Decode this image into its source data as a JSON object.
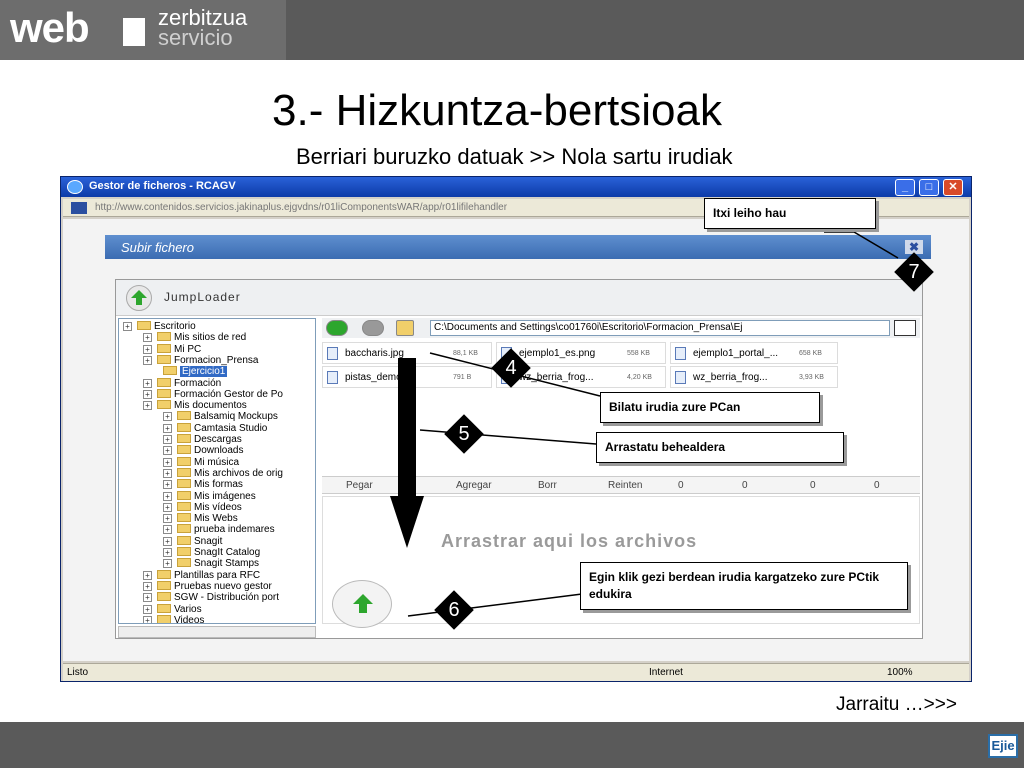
{
  "header": {
    "logo_web": "web",
    "logo_zerbitzua": "zerbitzua",
    "logo_servicio": "servicio"
  },
  "slide": {
    "title": "3.- Hizkuntza-bertsioak",
    "subtitle": "Berriari buruzko datuak >> Nola sartu irudiak",
    "next_link": "Jarraitu …>>>",
    "footer_logo": "Ejie"
  },
  "browser": {
    "title": "Gestor de ficheros - RCAGV",
    "url": "http://www.contenidos.servicios.jakinaplus.ejgvdns/r01liComponentsWAR/app/r01lifilehandler",
    "status_left": "Listo",
    "status_zone": "Internet",
    "status_zoom": "100%"
  },
  "dialog": {
    "title": "Subir fichero",
    "close": "✖"
  },
  "jumploader": {
    "title": "JumpLoader",
    "path": "C:\\Documents and Settings\\co01760i\\Escritorio\\Formacion_Prensa\\Ej",
    "tree": [
      {
        "label": "Escritorio",
        "indent": 0,
        "sel": false
      },
      {
        "label": "Mis sitios de red",
        "indent": 1,
        "sel": false
      },
      {
        "label": "Mi PC",
        "indent": 1,
        "sel": false
      },
      {
        "label": "Formacion_Prensa",
        "indent": 1,
        "sel": false
      },
      {
        "label": "Ejercicio1",
        "indent": 2,
        "sel": true
      },
      {
        "label": "Formación",
        "indent": 1,
        "sel": false
      },
      {
        "label": "Formación Gestor de Po",
        "indent": 1,
        "sel": false
      },
      {
        "label": "Mis documentos",
        "indent": 1,
        "sel": false
      },
      {
        "label": "Balsamiq Mockups",
        "indent": 2,
        "sel": false
      },
      {
        "label": "Camtasia Studio",
        "indent": 2,
        "sel": false
      },
      {
        "label": "Descargas",
        "indent": 2,
        "sel": false
      },
      {
        "label": "Downloads",
        "indent": 2,
        "sel": false
      },
      {
        "label": "Mi música",
        "indent": 2,
        "sel": false
      },
      {
        "label": "Mis archivos de orig",
        "indent": 2,
        "sel": false
      },
      {
        "label": "Mis formas",
        "indent": 2,
        "sel": false
      },
      {
        "label": "Mis imágenes",
        "indent": 2,
        "sel": false
      },
      {
        "label": "Mis vídeos",
        "indent": 2,
        "sel": false
      },
      {
        "label": "Mis Webs",
        "indent": 2,
        "sel": false
      },
      {
        "label": "prueba indemares",
        "indent": 2,
        "sel": false
      },
      {
        "label": "Snagit",
        "indent": 2,
        "sel": false
      },
      {
        "label": "SnagIt Catalog",
        "indent": 2,
        "sel": false
      },
      {
        "label": "Snagit Stamps",
        "indent": 2,
        "sel": false
      },
      {
        "label": "Plantillas para RFC",
        "indent": 1,
        "sel": false
      },
      {
        "label": "Pruebas nuevo gestor",
        "indent": 1,
        "sel": false
      },
      {
        "label": "SGW - Distribución port",
        "indent": 1,
        "sel": false
      },
      {
        "label": "Varios",
        "indent": 1,
        "sel": false
      },
      {
        "label": "Videos",
        "indent": 1,
        "sel": false
      }
    ],
    "files": [
      {
        "name": "baccharis.jpg",
        "size": "88,1 KB"
      },
      {
        "name": "ejemplo1_es.png",
        "size": "558 KB"
      },
      {
        "name": "ejemplo1_portal_...",
        "size": "658 KB"
      },
      {
        "name": "pistas_demo.txt",
        "size": "791 B"
      },
      {
        "name": "wz_berria_frog...",
        "size": "4,20 KB"
      },
      {
        "name": "wz_berria_frog...",
        "size": "3,93 KB"
      }
    ],
    "toolbar": {
      "paste": "Pegar",
      "add": "Agregar",
      "delete": "Borr",
      "retry": "Reinten",
      "c1": "0",
      "c2": "0",
      "c3": "0",
      "c4": "0"
    },
    "drop_text": "Arrastrar aqui los archivos"
  },
  "callouts": {
    "close": "Itxi leiho hau",
    "find": "Bilatu irudia zure PCan",
    "drag": "Arrastatu behealdera",
    "upload": "Egin klik gezi berdean irudia kargatzeko zure PCtik edukira"
  },
  "steps": [
    "4",
    "5",
    "6",
    "7"
  ]
}
